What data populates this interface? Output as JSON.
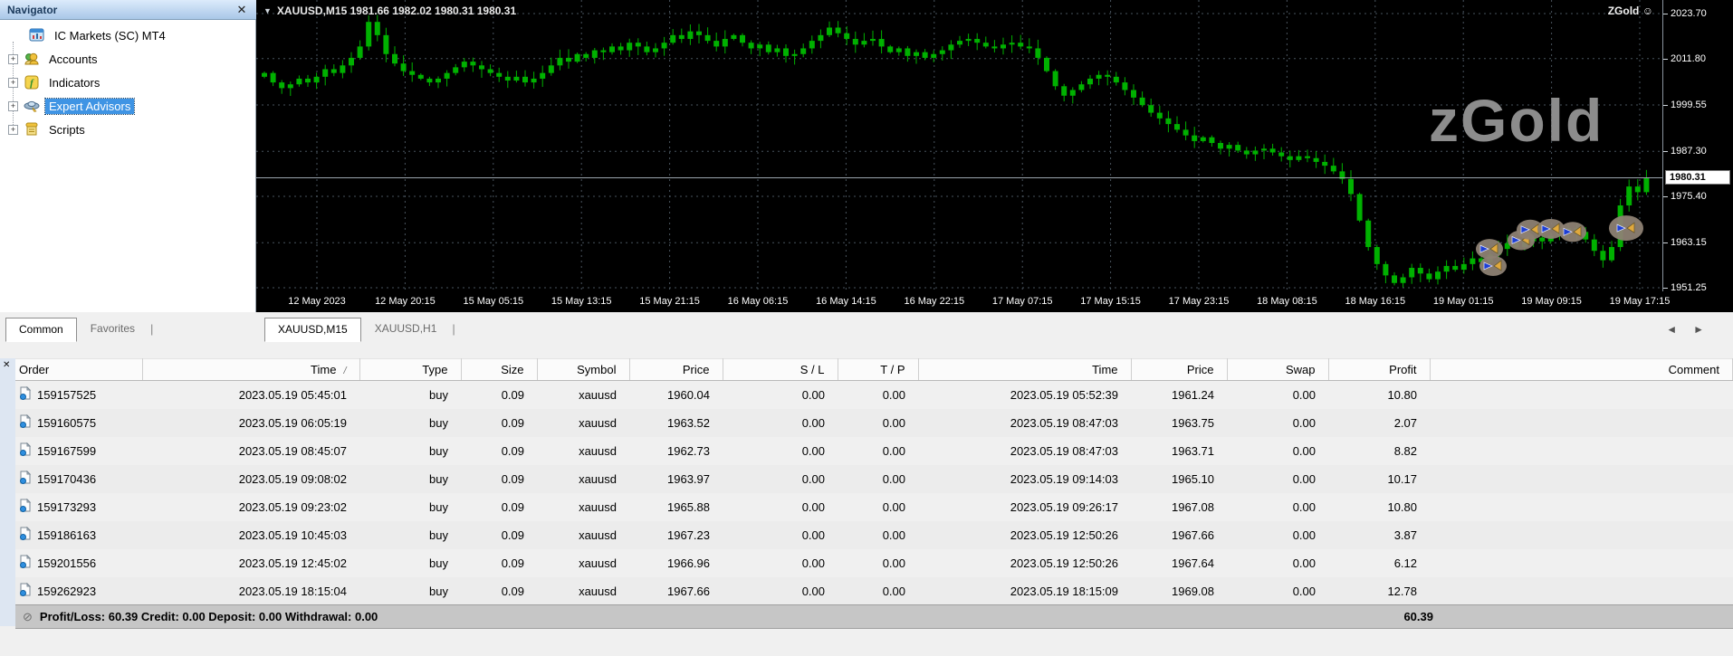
{
  "navigator": {
    "title": "Navigator",
    "close_glyph": "✕",
    "tree": [
      {
        "label": "IC Markets (SC) MT4",
        "icon": "mt4-terminal-icon",
        "expandable": false,
        "selected": false
      },
      {
        "label": "Accounts",
        "icon": "accounts-icon",
        "expandable": true,
        "selected": false
      },
      {
        "label": "Indicators",
        "icon": "indicators-icon",
        "expandable": true,
        "selected": false
      },
      {
        "label": "Expert Advisors",
        "icon": "expert-advisors-icon",
        "expandable": true,
        "selected": true
      },
      {
        "label": "Scripts",
        "icon": "scripts-icon",
        "expandable": true,
        "selected": false
      }
    ],
    "expander_glyph": "+",
    "tabs": [
      {
        "label": "Common",
        "active": true
      },
      {
        "label": "Favorites",
        "active": false
      }
    ],
    "tab_separator": "|"
  },
  "chart": {
    "dropdown_glyph": "▼",
    "header": "XAUUSD,M15  1981.66 1982.02 1980.31 1980.31",
    "ea_label": "ZGold",
    "ea_smiley": "☺",
    "watermark": "zGold",
    "current_price": "1980.31",
    "tabs": [
      {
        "label": "XAUUSD,M15",
        "active": true
      },
      {
        "label": "XAUUSD,H1",
        "active": false
      }
    ],
    "tab_separator": "|",
    "scroll_left_glyph": "◄",
    "scroll_right_glyph": "►"
  },
  "chart_data": {
    "type": "candlestick",
    "symbol": "XAUUSD",
    "timeframe": "M15",
    "title": "XAUUSD,M15 1981.66 1982.02 1980.31 1980.31",
    "ylim": [
      1951.25,
      2023.7
    ],
    "grid": true,
    "price_axis_labels": [
      "2023.70",
      "2011.80",
      "1999.55",
      "1987.30",
      "1975.40",
      "1963.15",
      "1951.25"
    ],
    "current_price": 1980.31,
    "x_labels": [
      "12 May 2023",
      "12 May 20:15",
      "15 May 05:15",
      "15 May 13:15",
      "15 May 21:15",
      "16 May 06:15",
      "16 May 14:15",
      "16 May 22:15",
      "17 May 07:15",
      "17 May 15:15",
      "17 May 23:15",
      "18 May 08:15",
      "18 May 16:15",
      "19 May 01:15",
      "19 May 09:15",
      "19 May 17:15"
    ],
    "price_path": [
      2008,
      2005.5,
      2004,
      2005,
      2006.5,
      2005.5,
      2007,
      2009,
      2008,
      2010,
      2012,
      2015,
      2021.5,
      2018,
      2013,
      2010.5,
      2008.5,
      2007.5,
      2006.5,
      2005.5,
      2006.5,
      2008,
      2009.5,
      2011,
      2010,
      2009,
      2008,
      2007,
      2006,
      2007,
      2005.5,
      2006.5,
      2008,
      2010,
      2012,
      2011,
      2013,
      2012,
      2014,
      2013.5,
      2015,
      2014,
      2016,
      2015,
      2013.5,
      2014.5,
      2016,
      2018,
      2017,
      2019,
      2018,
      2016.5,
      2015,
      2017,
      2018,
      2016,
      2014.5,
      2015.5,
      2013.5,
      2014.5,
      2012.5,
      2013,
      2014.5,
      2016.5,
      2018,
      2020,
      2018.5,
      2017,
      2015.5,
      2016.5,
      2017,
      2015,
      2013.5,
      2014.5,
      2012.5,
      2013.5,
      2012,
      2013,
      2014,
      2015.5,
      2016.5,
      2017,
      2016,
      2015,
      2014.5,
      2015.5,
      2016,
      2015,
      2014.5,
      2012,
      2008.5,
      2004.5,
      2002,
      2003.5,
      2005,
      2006.5,
      2007.5,
      2007,
      2005.5,
      2003.5,
      2001.5,
      1999.5,
      1997.5,
      1996,
      1994.5,
      1993,
      1991.5,
      1990,
      1991,
      1989.5,
      1988,
      1989,
      1987.5,
      1986.5,
      1987.5,
      1988,
      1987,
      1986,
      1985,
      1986,
      1985.5,
      1984.5,
      1983.5,
      1982,
      1980,
      1976,
      1969,
      1962,
      1957.5,
      1954.5,
      1952.5,
      1954,
      1956.5,
      1955,
      1953.5,
      1955.5,
      1957,
      1956,
      1957.5,
      1959,
      1958,
      1960,
      1961.5,
      1963,
      1962,
      1963.5,
      1964.5,
      1963.5,
      1965,
      1966,
      1967,
      1966,
      1964,
      1961,
      1958.5,
      1962,
      1973,
      1978,
      1976.5,
      1980.31
    ],
    "trade_markers": [
      {
        "x": 1645,
        "price": 1961.5
      },
      {
        "x": 1649,
        "price": 1957.0
      },
      {
        "x": 1680,
        "price": 1963.8
      },
      {
        "x": 1690,
        "price": 1966.6
      },
      {
        "x": 1713,
        "price": 1966.8
      },
      {
        "x": 1737,
        "price": 1966.0
      },
      {
        "x": 1796,
        "price": 1967.0,
        "big": true
      }
    ],
    "legend_position": "none"
  },
  "terminal": {
    "close_glyph": "✕",
    "columns": [
      "Order",
      "Time",
      "Type",
      "Size",
      "Symbol",
      "Price",
      "S / L",
      "T / P",
      "Time",
      "Price",
      "Swap",
      "Profit",
      "Comment"
    ],
    "sort_column_index": 1,
    "sort_glyph": "/",
    "rows": [
      [
        "159157525",
        "2023.05.19 05:45:01",
        "buy",
        "0.09",
        "xauusd",
        "1960.04",
        "0.00",
        "0.00",
        "2023.05.19 05:52:39",
        "1961.24",
        "0.00",
        "10.80",
        ""
      ],
      [
        "159160575",
        "2023.05.19 06:05:19",
        "buy",
        "0.09",
        "xauusd",
        "1963.52",
        "0.00",
        "0.00",
        "2023.05.19 08:47:03",
        "1963.75",
        "0.00",
        "2.07",
        ""
      ],
      [
        "159167599",
        "2023.05.19 08:45:07",
        "buy",
        "0.09",
        "xauusd",
        "1962.73",
        "0.00",
        "0.00",
        "2023.05.19 08:47:03",
        "1963.71",
        "0.00",
        "8.82",
        ""
      ],
      [
        "159170436",
        "2023.05.19 09:08:02",
        "buy",
        "0.09",
        "xauusd",
        "1963.97",
        "0.00",
        "0.00",
        "2023.05.19 09:14:03",
        "1965.10",
        "0.00",
        "10.17",
        ""
      ],
      [
        "159173293",
        "2023.05.19 09:23:02",
        "buy",
        "0.09",
        "xauusd",
        "1965.88",
        "0.00",
        "0.00",
        "2023.05.19 09:26:17",
        "1967.08",
        "0.00",
        "10.80",
        ""
      ],
      [
        "159186163",
        "2023.05.19 10:45:03",
        "buy",
        "0.09",
        "xauusd",
        "1967.23",
        "0.00",
        "0.00",
        "2023.05.19 12:50:26",
        "1967.66",
        "0.00",
        "3.87",
        ""
      ],
      [
        "159201556",
        "2023.05.19 12:45:02",
        "buy",
        "0.09",
        "xauusd",
        "1966.96",
        "0.00",
        "0.00",
        "2023.05.19 12:50:26",
        "1967.64",
        "0.00",
        "6.12",
        ""
      ],
      [
        "159262923",
        "2023.05.19 18:15:04",
        "buy",
        "0.09",
        "xauusd",
        "1967.66",
        "0.00",
        "0.00",
        "2023.05.19 18:15:09",
        "1969.08",
        "0.00",
        "12.78",
        ""
      ]
    ],
    "summary": {
      "icon_glyph": "⊘",
      "text": "Profit/Loss: 60.39  Credit: 0.00  Deposit: 0.00  Withdrawal: 0.00",
      "profit_total": "60.39"
    }
  },
  "colors": {
    "candle_green": "#00b100",
    "chart_bg": "#000000",
    "grid": "#49545e",
    "watermark": "#8c8c8c",
    "selection_blue": "#3f94e4",
    "marker_blob": "#8d8173",
    "marker_arrow_blue": "#1d3fd4",
    "marker_triangle_orange": "#e0a93e",
    "summary_bg": "#c6c6c6"
  }
}
